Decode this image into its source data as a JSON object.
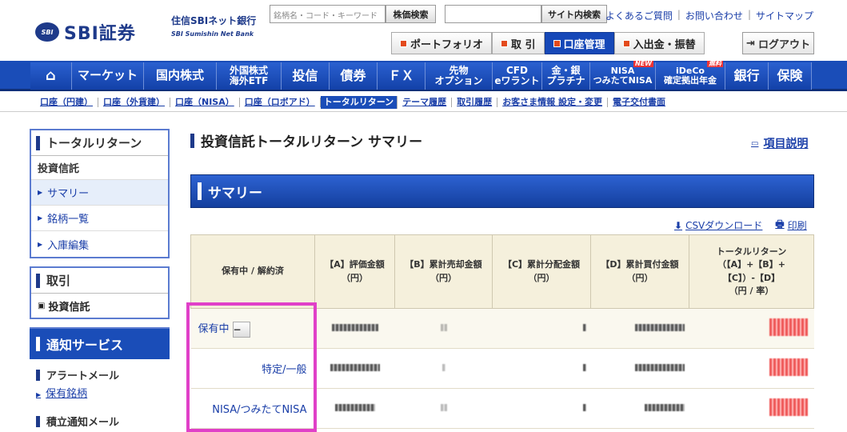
{
  "header": {
    "logo_mark": "SBI",
    "logo_text": "SBI証券",
    "bank_title": "住信SBIネット銀行",
    "bank_sub": "SBI Sumishin Net Bank",
    "stock_search_placeholder": "銘柄名・コード・キーワード",
    "stock_search_button": "株価検索",
    "site_search_button": "サイト内検索",
    "links": [
      "よくあるご質問",
      "お問い合わせ",
      "サイトマップ"
    ],
    "tabs": [
      "ポートフォリオ",
      "取 引",
      "口座管理",
      "入出金・振替"
    ],
    "logout": "ログアウト"
  },
  "nav": {
    "items": [
      "マーケット",
      "国内株式",
      "外国株式\n海外ETF",
      "投信",
      "債券",
      "ＦＸ",
      "先物\nオプション",
      "CFD\neワラント",
      "金・銀\nプラチナ",
      "NISA\nつみたてNISA",
      "iDeCo\n確定拠出年金",
      "銀行",
      "保険"
    ],
    "badge_new": "NEW",
    "badge_free": "無料"
  },
  "subnav": [
    "口座（円建）",
    "口座（外貨建）",
    "口座（NISA）",
    "口座（ロボアド）",
    "トータルリターン",
    "テーマ履歴",
    "取引履歴",
    "お客さま情報 設定・変更",
    "電子交付書面"
  ],
  "sidebar": {
    "total_return": "トータルリターン",
    "fund": "投資信託",
    "items": [
      "サマリー",
      "銘柄一覧",
      "入庫編集"
    ],
    "trade": "取引",
    "trade_item": "投資信託",
    "notif": "通知サービス",
    "alert": "アラートメール",
    "holdings": "保有銘柄",
    "reserve": "積立通知メール"
  },
  "main": {
    "title": "投資信託トータルリターン サマリー",
    "help": "項目説明",
    "summary": "サマリー",
    "csv": "CSVダウンロード",
    "print": "印刷"
  },
  "table": {
    "headers": [
      "保有中 / 解約済",
      "【A】評価金額\n（円）",
      "【B】累計売却金額\n（円）",
      "【C】累計分配金額\n（円）",
      "【D】累計買付金額\n（円）",
      "トータルリターン\n（【A】+【B】+\n【C】）-【D】\n（円 / 率）"
    ],
    "rows": [
      {
        "label": "保有中"
      },
      {
        "label": "特定/一般"
      },
      {
        "label": "NISA/つみたてNISA"
      }
    ]
  }
}
